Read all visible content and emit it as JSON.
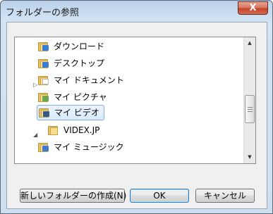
{
  "window": {
    "title": "フォルダーの参照",
    "close_label": "X"
  },
  "tree": {
    "items": [
      {
        "label": "ダウンロード",
        "expander": "",
        "badge_color": "#3a7bd5",
        "selected": false
      },
      {
        "label": "デスクトップ",
        "expander": "▷",
        "badge_color": "#3a7bd5",
        "selected": false
      },
      {
        "label": "マイ ドキュメント",
        "expander": "",
        "badge_color": "#f0f0f0",
        "selected": false
      },
      {
        "label": "マイ ピクチャ",
        "expander": "",
        "badge_color": "#6aa84f",
        "selected": false
      },
      {
        "label": "マイ ビデオ",
        "expander": "◢",
        "badge_color": "#355a8a",
        "selected": true
      },
      {
        "label": "VIDEX.JP",
        "expander": "",
        "badge_color": "",
        "selected": false
      },
      {
        "label": "マイ ミュージック",
        "expander": "",
        "badge_color": "#3a7bd5",
        "selected": false
      }
    ]
  },
  "buttons": {
    "new_folder": "新しいフォルダーの作成(N)",
    "ok": "OK",
    "cancel": "キャンセル"
  },
  "colors": {
    "selection_border": "#84acdd",
    "close_button": "#c5432a"
  }
}
